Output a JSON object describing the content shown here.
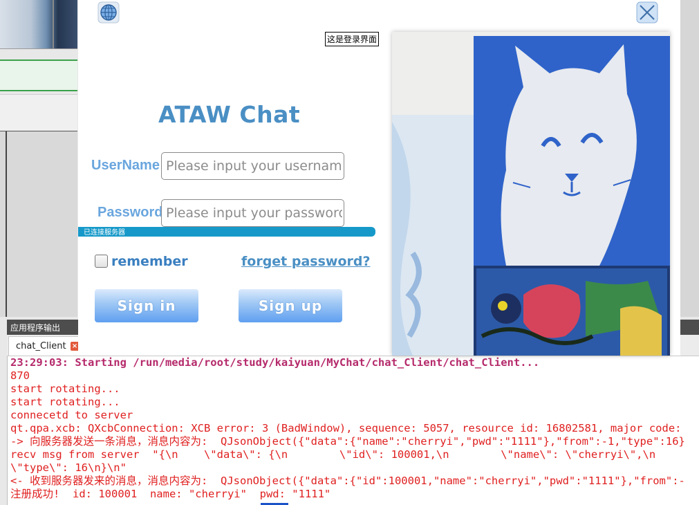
{
  "login": {
    "tooltip": "这是登录界面",
    "title": "ATAW Chat",
    "username_label": "UserName",
    "username_placeholder": "Please input your username",
    "password_label": "Password",
    "password_placeholder": "Please input your password",
    "status_text": "已连接服务器",
    "remember_label": "remember",
    "remember_checked": false,
    "forgot_label": "forget password?",
    "signin_label": "Sign in",
    "signup_label": "Sign up",
    "accent_color": "#4a8fc4",
    "status_color": "#1699c9"
  },
  "output": {
    "panel_title": "应用程序输出",
    "tab_label": "chat_Client",
    "lines": [
      "23:29:03: Starting /run/media/root/study/kaiyuan/MyChat/chat_Client/chat_Client...",
      "870",
      "start rotating...",
      "start rotating...",
      "connecetd to server",
      "qt.qpa.xcb: QXcbConnection: XCB error: 3 (BadWindow), sequence: 5057, resource id: 16802581, major code:",
      "-> 向服务器发送一条消息，消息内容为:  QJsonObject({\"data\":{\"name\":\"cherryi\",\"pwd\":\"1111\"},\"from\":-1,\"type\":16}",
      "recv msg from server  \"{\\n    \\\"data\\\": {\\n        \\\"id\\\": 100001,\\n        \\\"name\\\": \\\"cherryi\\\",\\n",
      "\\\"type\\\": 16\\n}\\n\"",
      "<- 收到服务器发来的消息，消息内容为:  QJsonObject({\"data\":{\"id\":100001,\"name\":\"cherryi\",\"pwd\":\"1111\"},\"from\":-",
      "注册成功!  id: 100001  name: \"cherryi\"  pwd: \"1111\""
    ]
  }
}
